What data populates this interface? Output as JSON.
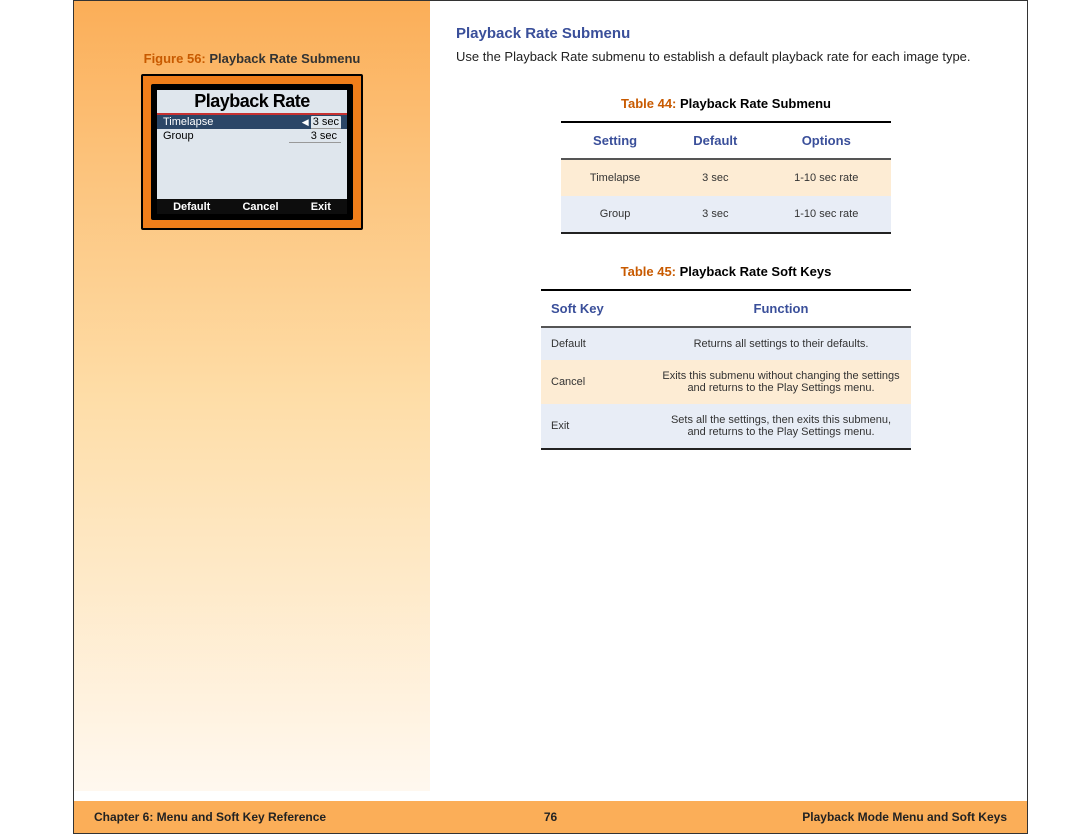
{
  "section_heading": "Playback Rate Submenu",
  "intro_text": "Use the Playback Rate submenu to establish a default playback rate for each image type.",
  "figure": {
    "label_prefix": "Figure 56:",
    "label_title": "Playback Rate Submenu",
    "screen_title": "Playback Rate",
    "row1_label": "Timelapse",
    "row1_value": "3 sec",
    "row2_label": "Group",
    "row2_value": "3 sec",
    "softkey1": "Default",
    "softkey2": "Cancel",
    "softkey3": "Exit"
  },
  "table44": {
    "caption_prefix": "Table 44:",
    "caption_title": "Playback Rate Submenu",
    "headers": {
      "c1": "Setting",
      "c2": "Default",
      "c3": "Options"
    },
    "rows": [
      {
        "c1": "Timelapse",
        "c2": "3 sec",
        "c3": "1-10 sec rate"
      },
      {
        "c1": "Group",
        "c2": "3 sec",
        "c3": "1-10 sec rate"
      }
    ]
  },
  "table45": {
    "caption_prefix": "Table 45:",
    "caption_title": "Playback Rate Soft Keys",
    "headers": {
      "c1": "Soft Key",
      "c2": "Function"
    },
    "rows": [
      {
        "c1": "Default",
        "c2": "Returns all settings to their defaults."
      },
      {
        "c1": "Cancel",
        "c2": "Exits this submenu without changing the settings and returns to the Play Settings menu."
      },
      {
        "c1": "Exit",
        "c2": "Sets all the settings, then exits this submenu, and returns to the Play Settings menu."
      }
    ]
  },
  "footer": {
    "left": "Chapter 6: Menu and Soft Key Reference",
    "center": "76",
    "right": "Playback Mode Menu and Soft Keys"
  }
}
